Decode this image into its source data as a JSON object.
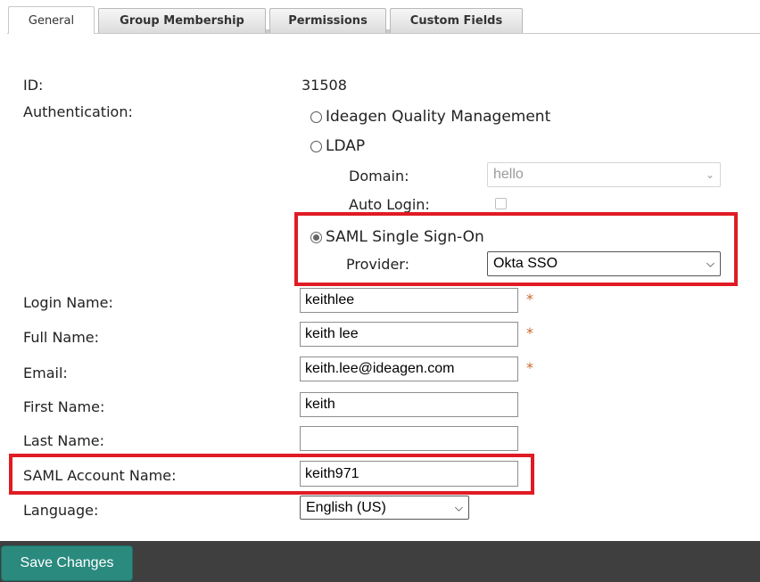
{
  "tabs": [
    {
      "label": "General",
      "active": true
    },
    {
      "label": "Group Membership",
      "active": false
    },
    {
      "label": "Permissions",
      "active": false
    },
    {
      "label": "Custom Fields",
      "active": false
    }
  ],
  "form": {
    "id_label": "ID:",
    "id_value": "31508",
    "auth_label": "Authentication:",
    "auth_options": {
      "iqm": "Ideagen Quality Management",
      "ldap": "LDAP",
      "saml": "SAML Single Sign-On"
    },
    "auth_selected": "saml",
    "domain_label": "Domain:",
    "domain_value": "hello",
    "auto_login_label": "Auto Login:",
    "provider_label": "Provider:",
    "provider_value": "Okta SSO",
    "login_name_label": "Login Name:",
    "login_name_value": "keithlee",
    "full_name_label": "Full Name:",
    "full_name_value": "keith lee",
    "email_label": "Email:",
    "email_value": "keith.lee@ideagen.com",
    "first_name_label": "First Name:",
    "first_name_value": "keith",
    "last_name_label": "Last Name:",
    "last_name_value": "",
    "saml_account_label": "SAML Account Name:",
    "saml_account_value": "keith971",
    "language_label": "Language:",
    "language_value": "English (US)",
    "required_mark": "*"
  },
  "footer": {
    "save_label": "Save Changes"
  },
  "colors": {
    "highlight": "#e01b24",
    "save_button": "#2a8a7e",
    "footer_bg": "#3f3f3f",
    "required": "#c9692a"
  }
}
